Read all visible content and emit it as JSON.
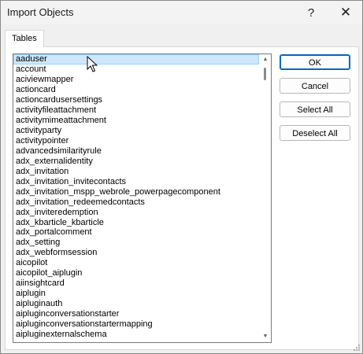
{
  "window": {
    "title": "Import Objects",
    "help_glyph": "?",
    "close_glyph": "✕"
  },
  "tabs": [
    {
      "label": "Tables",
      "active": true
    }
  ],
  "list": {
    "selected_index": 0,
    "items": [
      "aaduser",
      "account",
      "aciviewmapper",
      "actioncard",
      "actioncardusersettings",
      "activityfileattachment",
      "activitymimeattachment",
      "activityparty",
      "activitypointer",
      "advancedsimilarityrule",
      "adx_externalidentity",
      "adx_invitation",
      "adx_invitation_invitecontacts",
      "adx_invitation_mspp_webrole_powerpagecomponent",
      "adx_invitation_redeemedcontacts",
      "adx_inviteredemption",
      "adx_kbarticle_kbarticle",
      "adx_portalcomment",
      "adx_setting",
      "adx_webformsession",
      "aicopilot",
      "aicopilot_aiplugin",
      "aiinsightcard",
      "aiplugin",
      "aipluginauth",
      "aipluginconversationstarter",
      "aipluginconversationstartermapping",
      "aipluginexternalschema"
    ]
  },
  "buttons": {
    "ok": "OK",
    "cancel": "Cancel",
    "select_all": "Select All",
    "deselect_all": "Deselect All"
  },
  "colors": {
    "selection": "#cce8ff",
    "default_button_border": "#0067c0"
  }
}
